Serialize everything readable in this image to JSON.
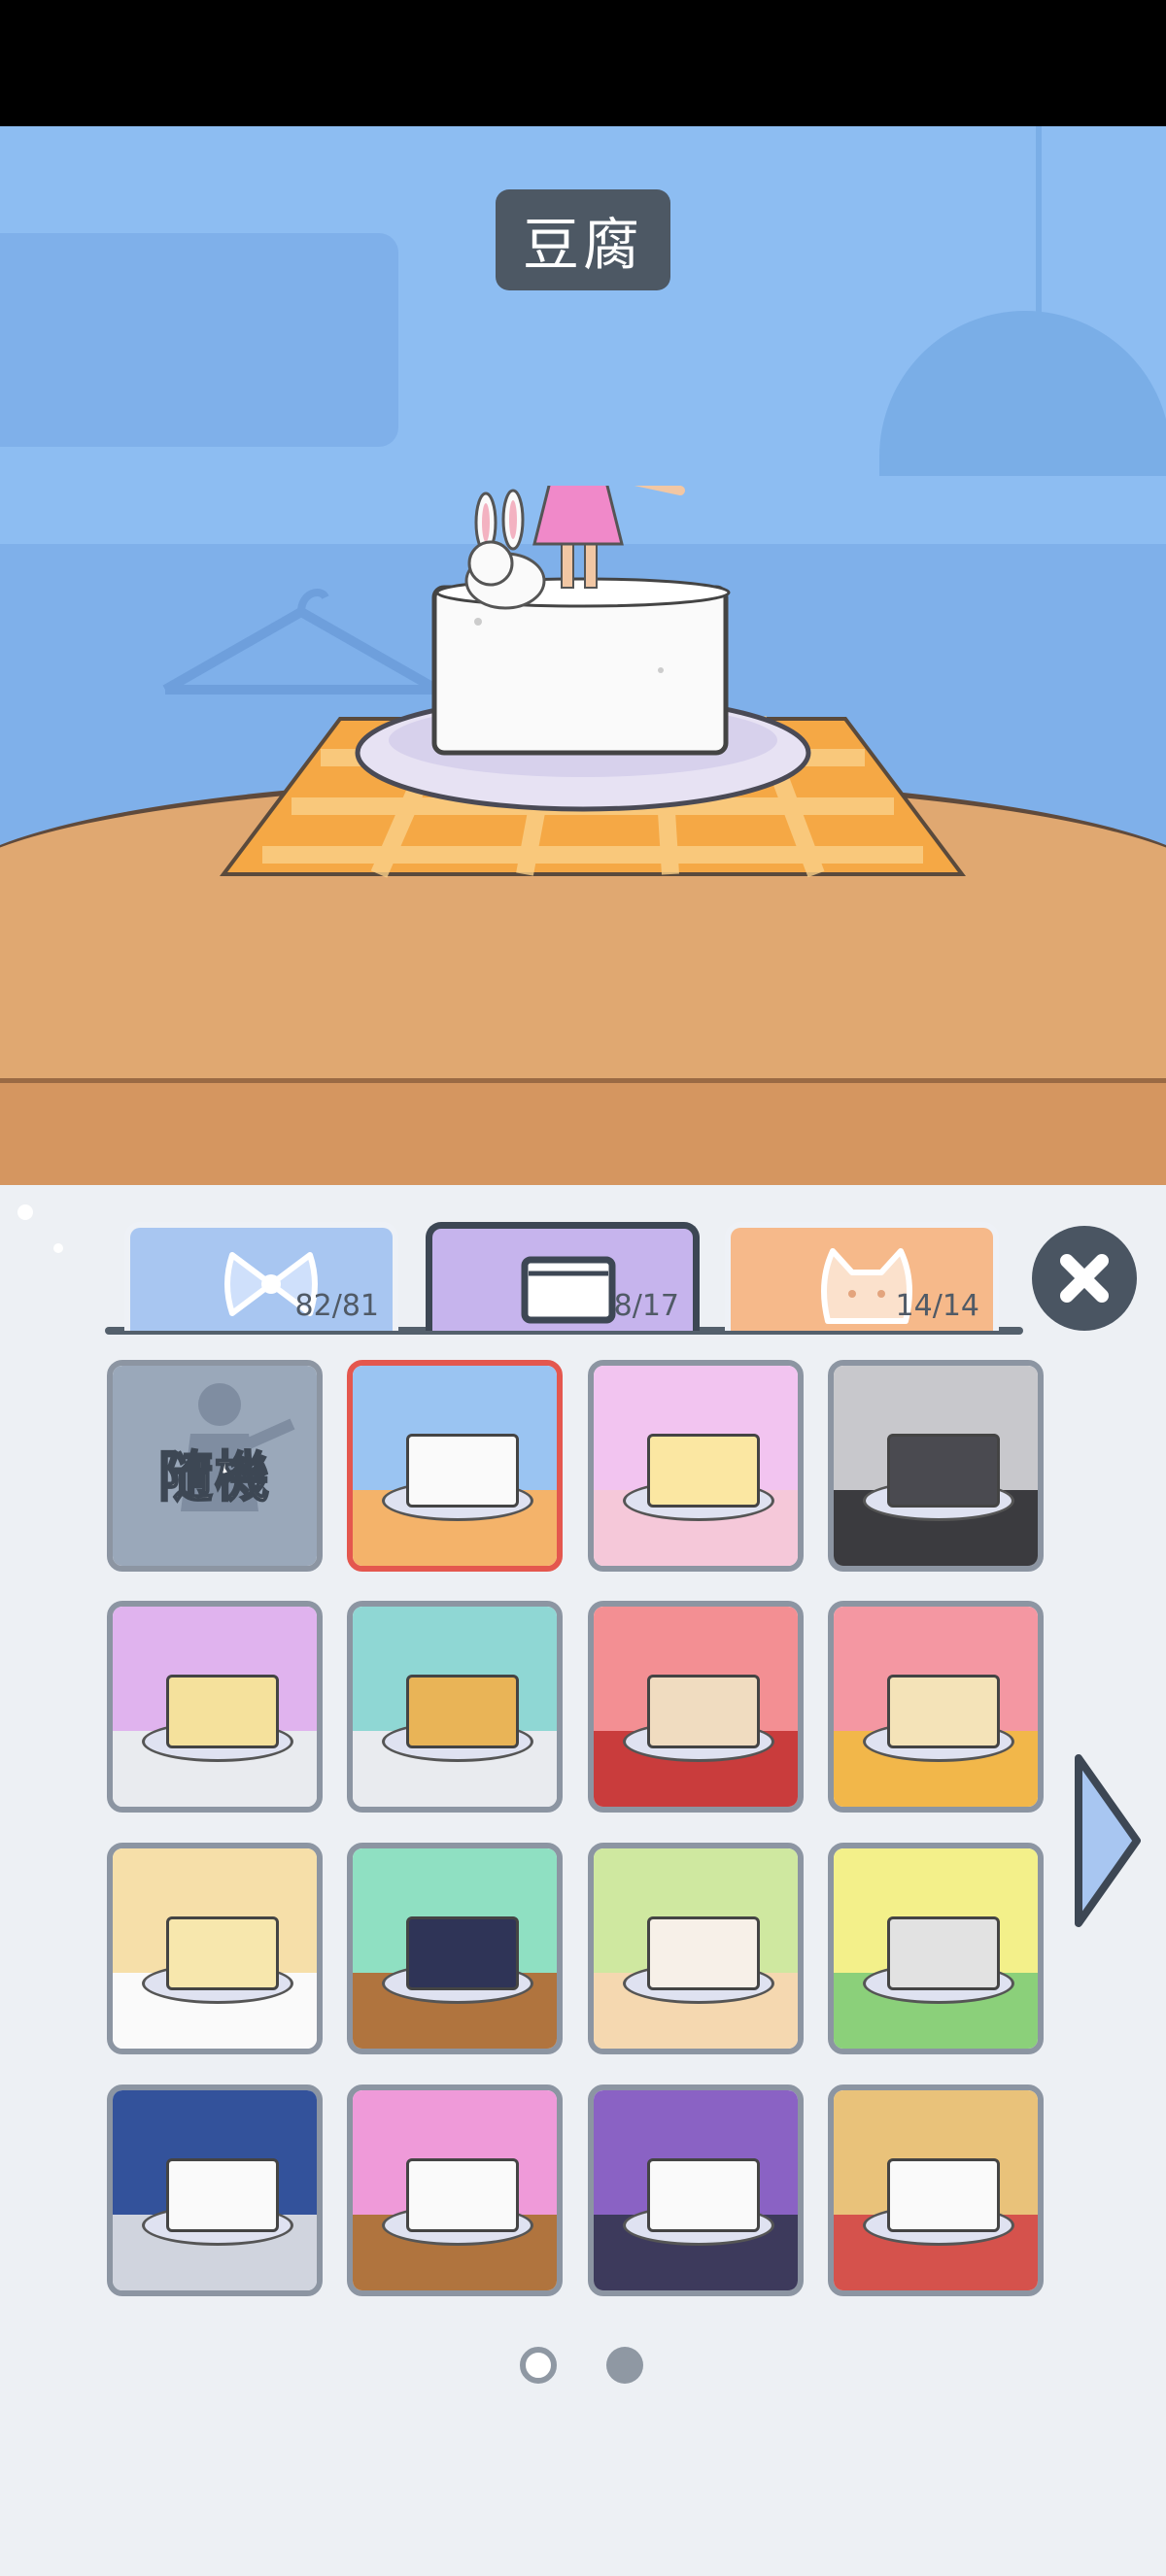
{
  "title": "豆腐",
  "tabs": [
    {
      "name": "bow-icon",
      "count": "82/81",
      "selected": false
    },
    {
      "name": "tofu-icon",
      "count": "8/17",
      "selected": true
    },
    {
      "name": "cat-icon",
      "count": "14/14",
      "selected": false
    }
  ],
  "random_label": "隨機",
  "grid": [
    {
      "name": "random-card",
      "sky": "#9aa8ba",
      "floor": "#9aa8ba"
    },
    {
      "name": "tofu-blue-card",
      "sky": "#9ac4f2",
      "floor": "#f4b36a",
      "selected": true,
      "item": "#fafafa"
    },
    {
      "name": "egg-tofu-card",
      "sky": "#f2c4f0",
      "floor": "#f5c8d9",
      "item": "#fbe7a2"
    },
    {
      "name": "black-tofu-card",
      "sky": "#c8c8cc",
      "floor": "#3b3b3f",
      "item": "#4a4a50"
    },
    {
      "name": "cheesecake-card",
      "sky": "#e0b3ee",
      "floor": "#e9ebef",
      "item": "#f5e19c"
    },
    {
      "name": "pizza-card",
      "sky": "#8fd7d4",
      "floor": "#e9ebef",
      "item": "#e9b457"
    },
    {
      "name": "bread-card",
      "sky": "#f38f93",
      "floor": "#c93c3c",
      "item": "#f0dcc0"
    },
    {
      "name": "melon-bun-card",
      "sky": "#f497a2",
      "floor": "#f2b74a",
      "item": "#f4e3b8"
    },
    {
      "name": "tofu-box-card",
      "sky": "#f6dfa9",
      "floor": "#fafafa",
      "item": "#f7e7ad"
    },
    {
      "name": "grill-card",
      "sky": "#8fe0c2",
      "floor": "#b0743e",
      "item": "#2f3457"
    },
    {
      "name": "cat-card",
      "sky": "#cfe8a0",
      "floor": "#f5d8b0",
      "item": "#f7f0e8"
    },
    {
      "name": "pillar-card",
      "sky": "#f3f08a",
      "floor": "#8bd07a",
      "item": "#e2e2e2"
    },
    {
      "name": "space-card",
      "sky": "#33529b",
      "floor": "#d0d4de",
      "item": "#fafafa"
    },
    {
      "name": "pink-city-card",
      "sky": "#ef9ad9",
      "floor": "#b0743e",
      "item": "#fafafa"
    },
    {
      "name": "halloween-card",
      "sky": "#8a62c4",
      "floor": "#3d3a5c",
      "item": "#fafafa"
    },
    {
      "name": "daifuku-card",
      "sky": "#e9c27a",
      "floor": "#d5524c",
      "item": "#fafafa"
    }
  ],
  "colors": {
    "accent": "#e4574e",
    "outline": "#3d4754",
    "panel": "#edf0f4"
  }
}
